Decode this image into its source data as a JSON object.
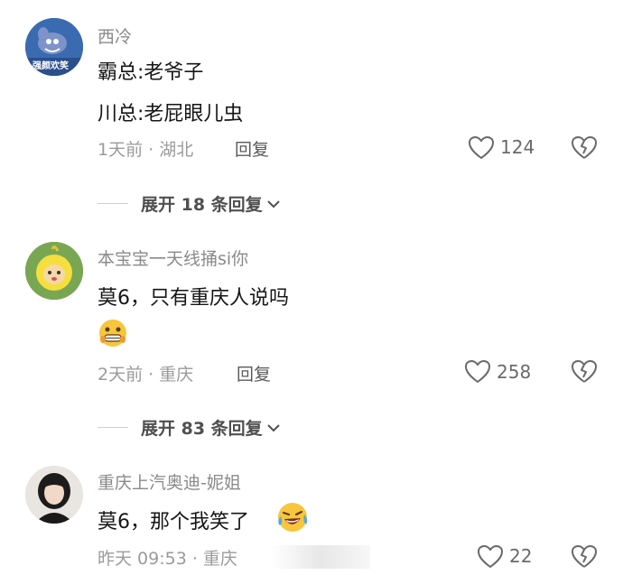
{
  "comments": [
    {
      "username": "西冷",
      "avatar_badge": "强颜欢笑",
      "lines": [
        "霸总:老爷子",
        "川总:老屁眼儿虫"
      ],
      "time_location": "1天前 · 湖北",
      "reply_label": "回复",
      "likes": "124",
      "expand_label": "展开 18 条回复"
    },
    {
      "username": "本宝宝一天线捅si你",
      "lines": [
        "莫6，只有重庆人说吗"
      ],
      "emoji": "grimacing-face",
      "time_location": "2天前 · 重庆",
      "reply_label": "回复",
      "likes": "258",
      "expand_label": "展开 83 条回复"
    },
    {
      "username": "重庆上汽奥迪-妮姐",
      "lines": [
        "莫6，那个我笑了"
      ],
      "emoji": "laughing-crying-face",
      "time_location": "昨天 09:53 · 重庆",
      "likes": "22"
    }
  ],
  "colors": {
    "text": "#161616",
    "secondary": "#9b9b9b",
    "username": "#8a8a8a",
    "divider": "#cfcfcf"
  }
}
